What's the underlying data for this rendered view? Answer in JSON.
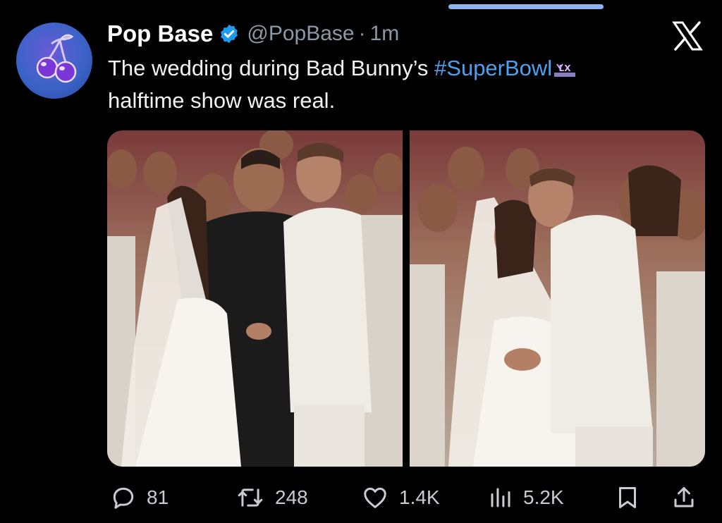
{
  "tweet": {
    "author_name": "Pop Base",
    "handle": "@PopBase",
    "separator": "·",
    "time": "1m",
    "text_before": "The wedding during Bad Bunny’s ",
    "hashtag": "#SuperBowl",
    "text_after": "halftime show was real.",
    "verified": true,
    "avatar_icon": "cherries-icon"
  },
  "media": {
    "left_photo": "wedding-ring-exchange-photo",
    "right_photo": "wedding-kiss-photo"
  },
  "actions": {
    "replies": "81",
    "retweets": "248",
    "likes": "1.4K",
    "views": "5.2K"
  },
  "colors": {
    "background": "#000000",
    "hashtag": "#4ba1f0",
    "verified": "#1d9bf0",
    "muted_text": "#8b98a5",
    "scroll_indicator": "#8fb3f0"
  }
}
